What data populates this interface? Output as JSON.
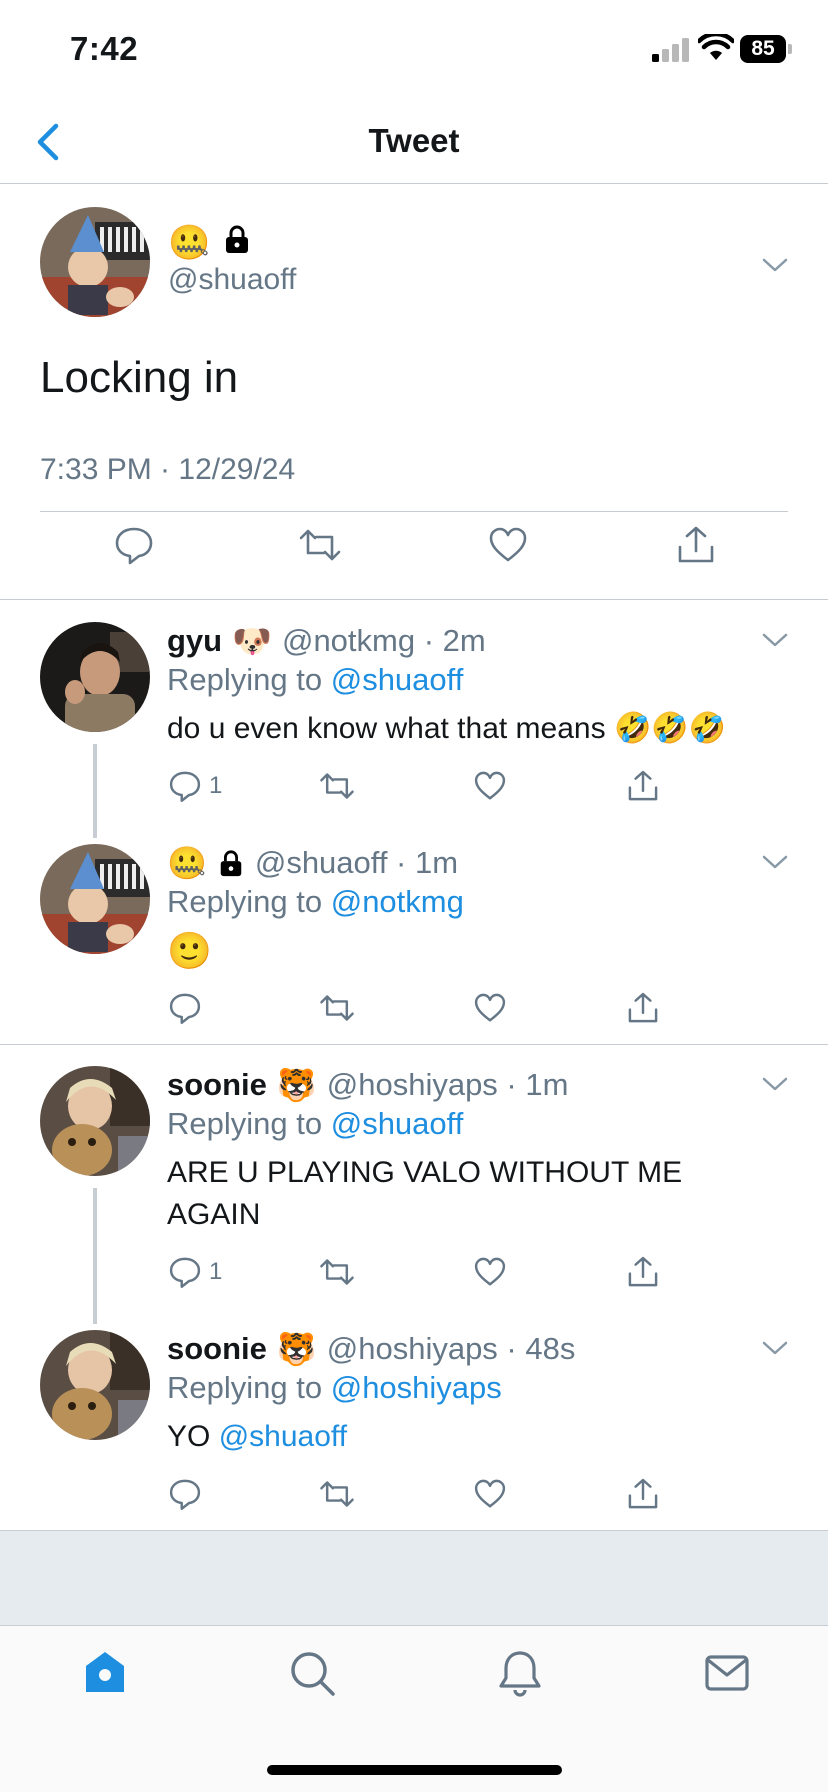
{
  "status_bar": {
    "time": "7:42",
    "battery": "85"
  },
  "header": {
    "title": "Tweet"
  },
  "main_tweet": {
    "emojis": [
      "🤐",
      "🔒"
    ],
    "handle": "@shuaoff",
    "text": "Locking in",
    "timestamp": "7:33 PM · 12/29/24"
  },
  "replies": [
    {
      "name": "gyu",
      "emoji": "🐶",
      "handle_time": "@notkmg · 2m",
      "replying_prefix": "Replying to",
      "replying_to": "@shuaoff",
      "text": "do u even know what that means 🤣🤣🤣",
      "reply_count": "1"
    },
    {
      "emojis": [
        "🤐",
        "🔒"
      ],
      "handle_time": "@shuaoff · 1m",
      "replying_prefix": "Replying to",
      "replying_to": "@notkmg",
      "text": "🙂"
    },
    {
      "name": "soonie",
      "emoji": "🐯",
      "handle_time": "@hoshiyaps · 1m",
      "replying_prefix": "Replying to",
      "replying_to": "@shuaoff",
      "text": "ARE U PLAYING VALO WITHOUT ME AGAIN",
      "reply_count": "1"
    },
    {
      "name": "soonie",
      "emoji": "🐯",
      "handle_time": "@hoshiyaps · 48s",
      "replying_prefix": "Replying to",
      "replying_to": "@hoshiyaps",
      "text_prefix": "YO",
      "text_mention": "@shuaoff"
    }
  ],
  "tabs": [
    "home-icon",
    "search-icon",
    "notifications-icon",
    "messages-icon"
  ],
  "colors": {
    "accent": "#1d8ee0",
    "muted": "#657786",
    "divider": "#c7cdd3"
  }
}
